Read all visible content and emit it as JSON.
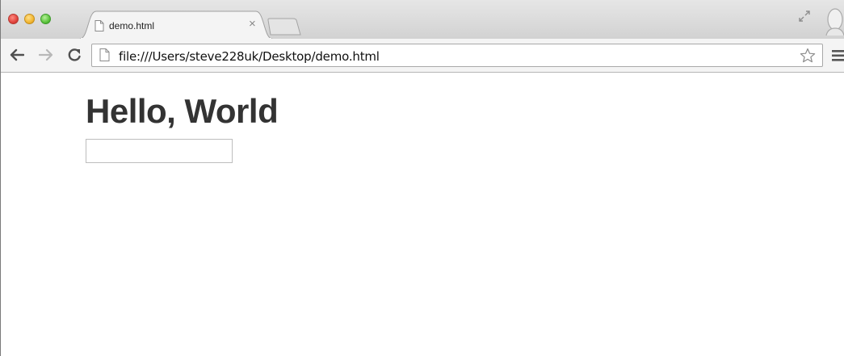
{
  "browser": {
    "tab": {
      "title": "demo.html",
      "close_glyph": "×"
    },
    "address_bar": {
      "url": "file:///Users/steve228uk/Desktop/demo.html"
    },
    "icons": {
      "window_controls": [
        "close-icon",
        "minimize-icon",
        "zoom-icon"
      ],
      "tab_favicon": "document-icon",
      "new_tab": "new-tab-icon",
      "fullscreen": "fullscreen-icon",
      "profile": "profile-icon",
      "back": "back-arrow-icon",
      "forward": "forward-arrow-icon",
      "reload": "reload-icon",
      "page": "document-icon",
      "bookmark": "star-icon",
      "menu": "menu-icon"
    }
  },
  "page": {
    "heading": "Hello, World",
    "input": {
      "value": "",
      "placeholder": ""
    }
  }
}
